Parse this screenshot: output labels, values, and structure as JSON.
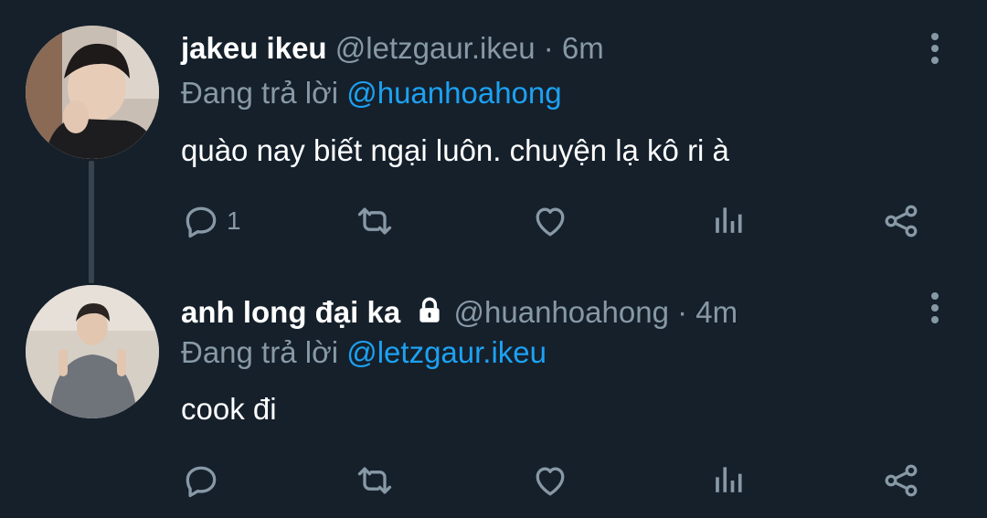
{
  "tweets": [
    {
      "name": "jakeu ikeu",
      "handle": "@letzgaur.ikeu",
      "separator": "·",
      "time": "6m",
      "reply_prefix": "Đang trả lời",
      "reply_to": "@huanhoahong",
      "text": "quào nay biết ngại luôn. chuyện lạ kô ri à",
      "reply_count": "1",
      "protected": false
    },
    {
      "name": "anh long đại ka",
      "handle": "@huanhoahong",
      "separator": "·",
      "time": "4m",
      "reply_prefix": "Đang trả lời",
      "reply_to": "@letzgaur.ikeu",
      "text": "cook đi",
      "reply_count": "",
      "protected": true
    }
  ],
  "icons": {
    "reply": "reply-icon",
    "retweet": "retweet-icon",
    "like": "heart-icon",
    "stats": "stats-icon",
    "share": "share-icon",
    "more": "more-vertical-icon",
    "lock": "lock-icon"
  },
  "colors": {
    "background": "#15202b",
    "text": "#ffffff",
    "muted": "#8899a6",
    "link": "#1da1f2",
    "thread_line": "#38444d"
  }
}
